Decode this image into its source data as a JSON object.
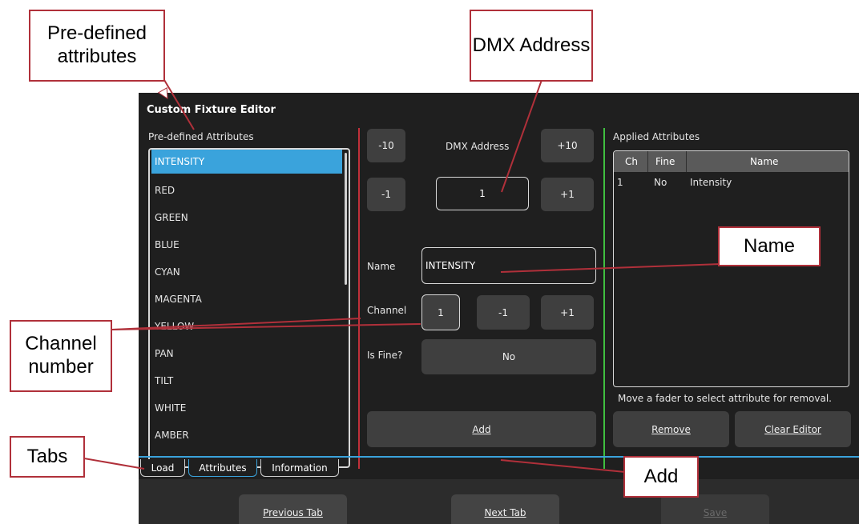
{
  "editor": {
    "title": "Custom Fixture Editor",
    "predefined_label": "Pre-defined Attributes",
    "attributes": [
      "INTENSITY",
      "RED",
      "GREEN",
      "BLUE",
      "CYAN",
      "MAGENTA",
      "YELLOW",
      "PAN",
      "TILT",
      "WHITE",
      "AMBER"
    ],
    "selected_attribute": "INTENSITY",
    "dmx": {
      "label": "DMX Address",
      "value": "1",
      "minus10": "-10",
      "plus10": "+10",
      "minus1": "-1",
      "plus1": "+1"
    },
    "name": {
      "label": "Name",
      "value": "INTENSITY"
    },
    "channel": {
      "label": "Channel",
      "value": "1",
      "minus1": "-1",
      "plus1": "+1"
    },
    "is_fine": {
      "label": "Is Fine?",
      "value": "No"
    },
    "add_button": "Add",
    "applied": {
      "label": "Applied Attributes",
      "columns": [
        "Ch",
        "Fine",
        "Name"
      ],
      "rows": [
        {
          "ch": "1",
          "fine": "No",
          "name": "Intensity"
        }
      ],
      "hint": "Move a fader to select attribute for removal.",
      "remove_button": "Remove",
      "clear_button": "Clear Editor"
    },
    "tabs": [
      "Load",
      "Attributes",
      "Information"
    ],
    "active_tab": "Attributes",
    "footer": {
      "previous": "Previous Tab",
      "next": "Next Tab",
      "save": "Save"
    }
  },
  "annotations": {
    "predefined": "Pre-defined attributes",
    "dmx": "DMX Address",
    "name": "Name",
    "channel": "Channel number",
    "tabs": "Tabs",
    "add": "Add"
  },
  "colors": {
    "accent": "#3aa3dc",
    "callout_border": "#b0303a",
    "divider_red": "#c0303a",
    "divider_green": "#3fbf3f"
  }
}
